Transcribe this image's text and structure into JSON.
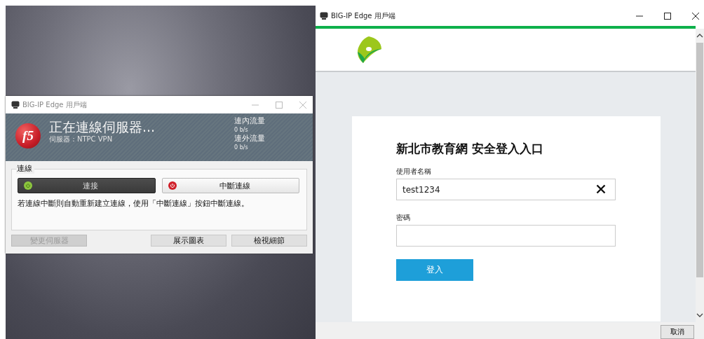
{
  "vpn_window": {
    "title": "BIG-IP Edge 用戶端",
    "logo_text": "f5",
    "status": "正在連線伺服器...",
    "server": "伺服器：NTPC VPN",
    "traffic": [
      {
        "label": "連內流量",
        "value": "0 b/s"
      },
      {
        "label": "連外流量",
        "value": "0 b/s"
      }
    ],
    "group_label": "連線",
    "actions": [
      {
        "label": "連接",
        "kind": "connect",
        "pressed": true
      },
      {
        "label": "中斷連線",
        "kind": "disconnect",
        "pressed": false
      }
    ],
    "note": "若連線中斷則自動重新建立連線，使用「中斷連線」按鈕中斷連線。",
    "buttons": [
      {
        "label": "變更伺服器",
        "disabled": true
      },
      {
        "label": "展示圖表",
        "disabled": false
      },
      {
        "label": "檢視細節",
        "disabled": false
      }
    ]
  },
  "login_window": {
    "title": "BIG-IP Edge 用戶端",
    "heading": "新北市教育網 安全登入入口",
    "fields": [
      {
        "label": "使用者名稱",
        "value": "test1234",
        "clearable": true
      },
      {
        "label": "密碼",
        "clearable": false
      }
    ],
    "submit": "登入",
    "cancel": "取消"
  }
}
